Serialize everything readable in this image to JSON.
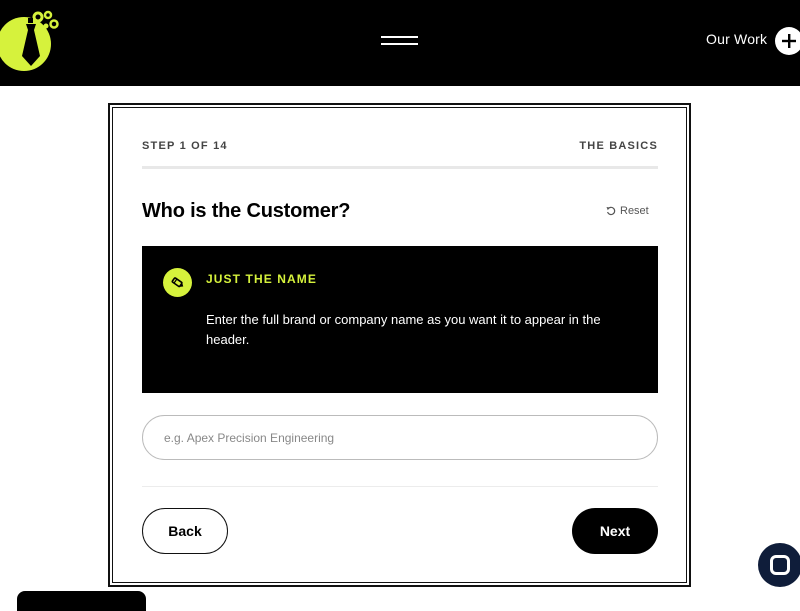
{
  "header": {
    "nav_link": "Our Work",
    "logo_icon": "necktie-logo-icon",
    "menu_icon": "hamburger-menu-icon",
    "plus_icon": "plus-icon"
  },
  "wizard": {
    "step_label": "STEP 1 OF 14",
    "section_label": "THE BASICS",
    "progress": {
      "current": 1,
      "total": 14
    },
    "question": "Who is the Customer?",
    "reset_label": "Reset",
    "hint": {
      "icon": "pencil-icon",
      "title": "JUST THE NAME",
      "body": "Enter the full brand or company name as you want it to appear in the header."
    },
    "input": {
      "value": "",
      "placeholder": "e.g. Apex Precision Engineering"
    },
    "back_label": "Back",
    "next_label": "Next"
  },
  "colors": {
    "accent": "#d6f23c",
    "dark": "#000000",
    "chat": "#0f1d3a"
  }
}
